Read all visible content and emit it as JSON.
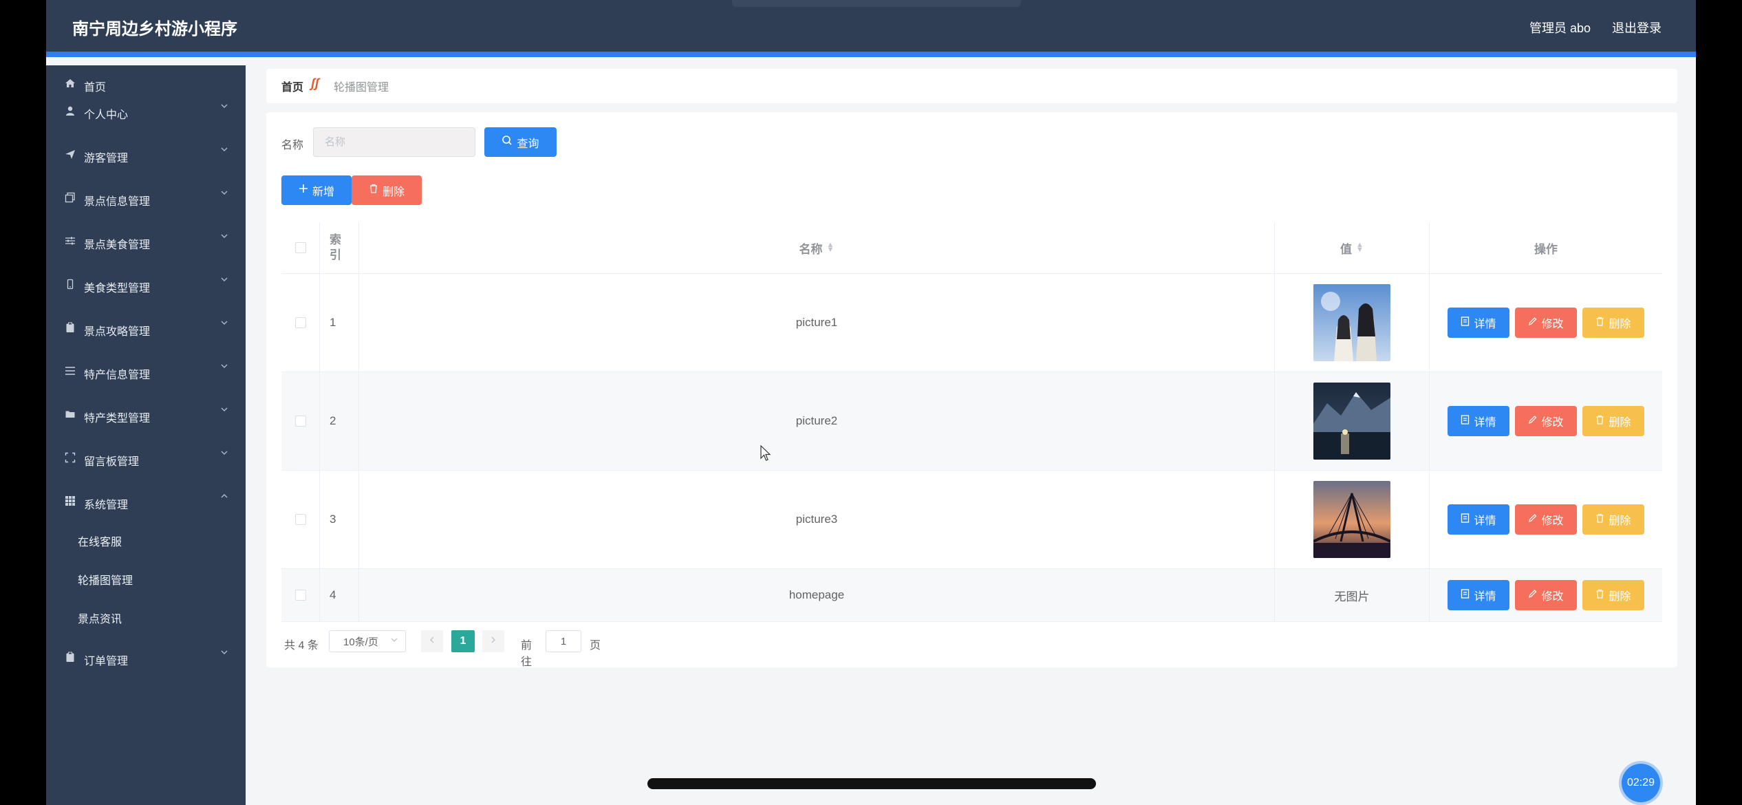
{
  "app": {
    "title": "南宁周边乡村游小程序"
  },
  "header": {
    "user": "管理员 abo",
    "logout": "退出登录"
  },
  "sidebar": {
    "items": [
      {
        "label": "首页",
        "icon": "home-icon"
      },
      {
        "label": "个人中心",
        "icon": "user-icon"
      },
      {
        "label": "游客管理",
        "icon": "paper-plane-icon"
      },
      {
        "label": "景点信息管理",
        "icon": "copy-icon"
      },
      {
        "label": "景点美食管理",
        "icon": "sliders-icon"
      },
      {
        "label": "美食类型管理",
        "icon": "mobile-icon"
      },
      {
        "label": "景点攻略管理",
        "icon": "clipboard-icon"
      },
      {
        "label": "特产信息管理",
        "icon": "list-icon"
      },
      {
        "label": "特产类型管理",
        "icon": "folder-icon"
      },
      {
        "label": "留言板管理",
        "icon": "fullscreen-icon"
      },
      {
        "label": "系统管理",
        "icon": "grid-icon"
      },
      {
        "label": "订单管理",
        "icon": "clipboard-icon"
      }
    ],
    "system_sub": [
      "在线客服",
      "轮播图管理",
      "景点资讯"
    ]
  },
  "breadcrumb": {
    "home": "首页",
    "current": "轮播图管理"
  },
  "search": {
    "label": "名称",
    "placeholder": "名称",
    "query_label": "查询"
  },
  "actions": {
    "add_label": "新增",
    "delete_label": "删除"
  },
  "table": {
    "headers": {
      "index": "索引",
      "name": "名称",
      "value": "值",
      "ops": "操作"
    },
    "rows": [
      {
        "index": "1",
        "name": "picture1",
        "value_text": "",
        "image": "image-portrait"
      },
      {
        "index": "2",
        "name": "picture2",
        "value_text": "",
        "image": "image-mountain-lake"
      },
      {
        "index": "3",
        "name": "picture3",
        "value_text": "",
        "image": "image-bridge-sunset"
      },
      {
        "index": "4",
        "name": "homepage",
        "value_text": "无图片",
        "image": ""
      }
    ],
    "op_labels": {
      "detail": "详情",
      "edit": "修改",
      "delete": "删除"
    }
  },
  "pagination": {
    "total": "共 4 条",
    "page_size": "10条/页",
    "current": "1",
    "goto": "前往",
    "page_input": "1",
    "page_unit": "页"
  },
  "status": {
    "time": "02:29"
  },
  "colors": {
    "primary": "#2e88f4",
    "danger": "#f56f5c",
    "warning": "#f7c04b",
    "sidebar": "#2f3e55",
    "pager_active": "#2aa89a"
  }
}
